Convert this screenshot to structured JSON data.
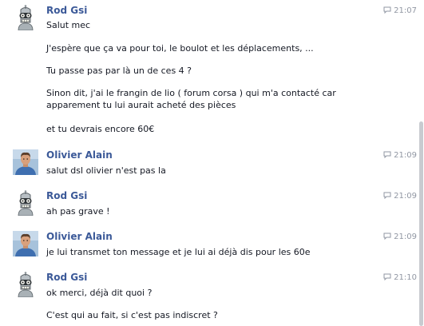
{
  "messages": [
    {
      "sender": "Rod Gsi",
      "avatar": "robot-avatar",
      "time": "21:07",
      "lines": [
        "Salut mec",
        "J'espère que ça va pour toi, le boulot et les déplacements, ...",
        "Tu passe pas par là un de ces 4 ?",
        "Sinon dit, j'ai le frangin de lio ( forum corsa ) qui m'a contacté car\napparement tu lui aurait acheté des pièces",
        "et tu devrais encore 60€"
      ]
    },
    {
      "sender": "Olivier Alain",
      "avatar": "person-avatar",
      "time": "21:09",
      "lines": [
        "salut dsl olivier n'est pas la"
      ]
    },
    {
      "sender": "Rod Gsi",
      "avatar": "robot-avatar",
      "time": "21:09",
      "lines": [
        "ah pas grave !"
      ]
    },
    {
      "sender": "Olivier Alain",
      "avatar": "person-avatar",
      "time": "21:09",
      "lines": [
        "je lui transmet ton message et je lui ai déjà dis pour les 60e"
      ]
    },
    {
      "sender": "Rod Gsi",
      "avatar": "robot-avatar",
      "time": "21:10",
      "lines": [
        "ok merci, déjà dit quoi ?",
        "C'est qui au fait, si c'est pas indiscret ?"
      ]
    }
  ],
  "colors": {
    "sender": "#3b5998",
    "timestamp": "#9197a3",
    "text": "#141823"
  },
  "icons": {
    "timestamp": "chat-bubble-icon"
  }
}
